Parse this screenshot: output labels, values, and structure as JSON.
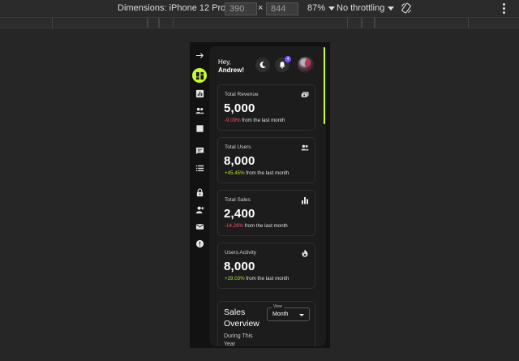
{
  "devtools": {
    "device_label": "Dimensions: iPhone 12 Pro",
    "width_value": "390",
    "height_value": "844",
    "times": "×",
    "zoom": "87%",
    "throttling": "No throttling"
  },
  "sidebar": {
    "items": [
      {
        "name": "collapse-arrow",
        "icon": "arrow-right-icon",
        "active": false
      },
      {
        "name": "dashboard",
        "icon": "dashboard-icon",
        "active": true
      },
      {
        "name": "analytics",
        "icon": "bar-chart-icon",
        "active": false
      },
      {
        "name": "team",
        "icon": "people-icon",
        "active": false
      },
      {
        "name": "pages",
        "icon": "square-icon",
        "active": false
      },
      {
        "name": "messages",
        "icon": "chat-icon",
        "active": false
      },
      {
        "name": "list",
        "icon": "list-icon",
        "active": false
      },
      {
        "name": "security",
        "icon": "lock-icon",
        "active": false
      },
      {
        "name": "add-user",
        "icon": "person-add-icon",
        "active": false
      },
      {
        "name": "mail",
        "icon": "mail-icon",
        "active": false
      },
      {
        "name": "info",
        "icon": "alert-icon",
        "active": false
      }
    ],
    "accent": "#c8ff2e"
  },
  "header": {
    "greeting": "Hey,",
    "name": "Andrew!",
    "notification_count": "4"
  },
  "cards": [
    {
      "label": "Total Revenue",
      "value": "5,000",
      "delta": "-9.09%",
      "delta_type": "neg",
      "suffix": " from the last month",
      "icon": "payments-icon"
    },
    {
      "label": "Total Users",
      "value": "8,000",
      "delta": "+45.45%",
      "delta_type": "pos",
      "suffix": " from the last month",
      "icon": "people-icon"
    },
    {
      "label": "Total Sales",
      "value": "2,400",
      "delta": "-14.29%",
      "delta_type": "neg",
      "suffix": " from the last month",
      "icon": "bar-chart-icon"
    },
    {
      "label": "Users Activity",
      "value": "8,000",
      "delta": "+29.03%",
      "delta_type": "pos",
      "suffix": " from the last month",
      "icon": "fire-icon"
    }
  ],
  "overview": {
    "title": "Sales Overview",
    "subtitle": "During This Year",
    "view_legend": "View",
    "view_value": "Month"
  },
  "colors": {
    "negative": "#ff4d6d",
    "positive": "#a8e63a",
    "badge": "#7b4dff"
  }
}
